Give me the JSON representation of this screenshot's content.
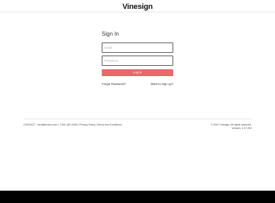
{
  "header": {
    "logo_text": "Vinesign"
  },
  "signin": {
    "title": "Sign In",
    "email_placeholder": "Email",
    "password_placeholder": "Password",
    "login_label": "Log in",
    "forgot_label": "Forgot Password?",
    "signup_label": "Want to Sign up?"
  },
  "footer": {
    "contact_prefix": "CONTACT :",
    "contact_email": "info@femine.com",
    "separator": "|",
    "phone": "T 801-487-9165",
    "privacy_label": "Privacy Policy",
    "terms_label": "Terms and Conditions",
    "copyright": "© 2007 Vinesign. All rights reserved.",
    "version": "Version: 1.17.232"
  },
  "colors": {
    "accent": "#e8696b",
    "taskbar": "#000000"
  }
}
